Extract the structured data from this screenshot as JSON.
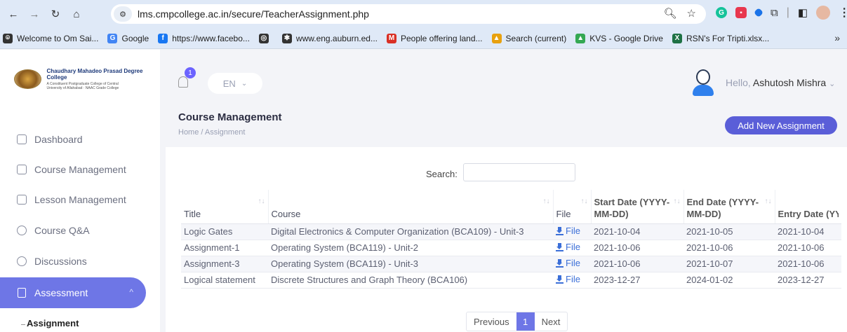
{
  "browser": {
    "url": "lms.cmpcollege.ac.in/secure/TeacherAssignment.php",
    "bookmarks": [
      {
        "label": "Welcome to Om Sai...",
        "color": "#333333",
        "glyph": "⌾"
      },
      {
        "label": "Google",
        "color": "#4285f4",
        "glyph": "G"
      },
      {
        "label": "https://www.facebo...",
        "color": "#1877f2",
        "glyph": "f"
      },
      {
        "label": "",
        "color": "#333333",
        "glyph": "◎"
      },
      {
        "label": "www.eng.auburn.ed...",
        "color": "#333333",
        "glyph": "✱"
      },
      {
        "label": "People offering land...",
        "color": "#d93025",
        "glyph": "M"
      },
      {
        "label": "Search (current)",
        "color": "#e8a10f",
        "glyph": "▲"
      },
      {
        "label": "KVS - Google Drive",
        "color": "#34a853",
        "glyph": "▲"
      },
      {
        "label": "RSN's For Tripti.xlsx...",
        "color": "#1e7145",
        "glyph": "X"
      }
    ]
  },
  "brand": {
    "title": "Chaudhary Mahadeo Prasad Degree College",
    "subtitle": "A Constituent Postgraduate College of Central University of Allahabad · NAAC Grade College"
  },
  "sidebar": {
    "items": [
      {
        "label": "Dashboard"
      },
      {
        "label": "Course Management"
      },
      {
        "label": "Lesson Management"
      },
      {
        "label": "Course Q&A"
      },
      {
        "label": "Discussions"
      }
    ],
    "active": "Assessment",
    "sub_active": "Assignment"
  },
  "header": {
    "notification_count": "1",
    "language": "EN",
    "hello": "Hello,",
    "user_name": "Ashutosh Mishra"
  },
  "page": {
    "title": "Course Management",
    "breadcrumb": "Home  /  Assignment",
    "add_button": "Add New Assignment",
    "search_label": "Search:"
  },
  "table": {
    "columns": [
      "Title",
      "Course",
      "File",
      "Start Date (YYYY-MM-DD)",
      "End Date (YYYY-MM-DD)",
      "Entry Date (YYYY-MM-D"
    ],
    "rows": [
      {
        "title": "Logic Gates",
        "course": "Digital Electronics & Computer Organization (BCA109) - Unit-3",
        "file": "File",
        "start": "2021-10-04",
        "end": "2021-10-05",
        "entry": "2021-10-04"
      },
      {
        "title": "Assignment-1",
        "course": "Operating System (BCA119) - Unit-2",
        "file": "File",
        "start": "2021-10-06",
        "end": "2021-10-06",
        "entry": "2021-10-06"
      },
      {
        "title": "Assignment-3",
        "course": "Operating System (BCA119) - Unit-3",
        "file": "File",
        "start": "2021-10-06",
        "end": "2021-10-07",
        "entry": "2021-10-06"
      },
      {
        "title": "Logical statement",
        "course": "Discrete Structures and Graph Theory (BCA106)",
        "file": "File",
        "start": "2023-12-27",
        "end": "2024-01-02",
        "entry": "2023-12-27"
      }
    ]
  },
  "pagination": {
    "previous": "Previous",
    "current": "1",
    "next": "Next"
  }
}
